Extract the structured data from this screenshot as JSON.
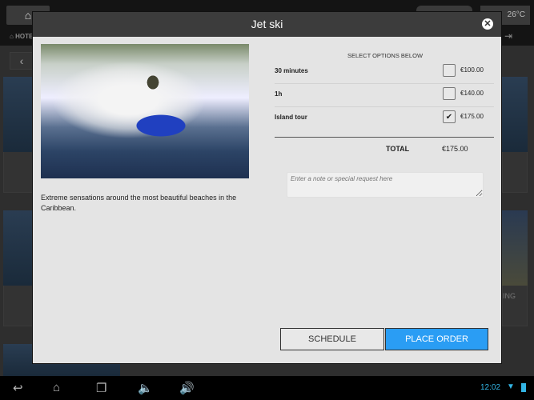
{
  "background": {
    "weather": "26°C",
    "crumb": "HOTEL",
    "side_label": "ING"
  },
  "modal": {
    "title": "Jet ski",
    "description": "Extreme sensations around the most beautiful beaches in the Caribbean.",
    "options_title": "SELECT OPTIONS BELOW",
    "options": [
      {
        "label": "30 minutes",
        "price": "€100.00",
        "checked": false
      },
      {
        "label": "1h",
        "price": "€140.00",
        "checked": false
      },
      {
        "label": "Island tour",
        "price": "€175.00",
        "checked": true
      }
    ],
    "total_label": "TOTAL",
    "total_value": "€175.00",
    "note_placeholder": "Enter a note or special request here",
    "schedule_label": "SCHEDULE",
    "order_label": "PLACE ORDER",
    "accent": "#2a9df4"
  },
  "status": {
    "time": "12:02"
  }
}
